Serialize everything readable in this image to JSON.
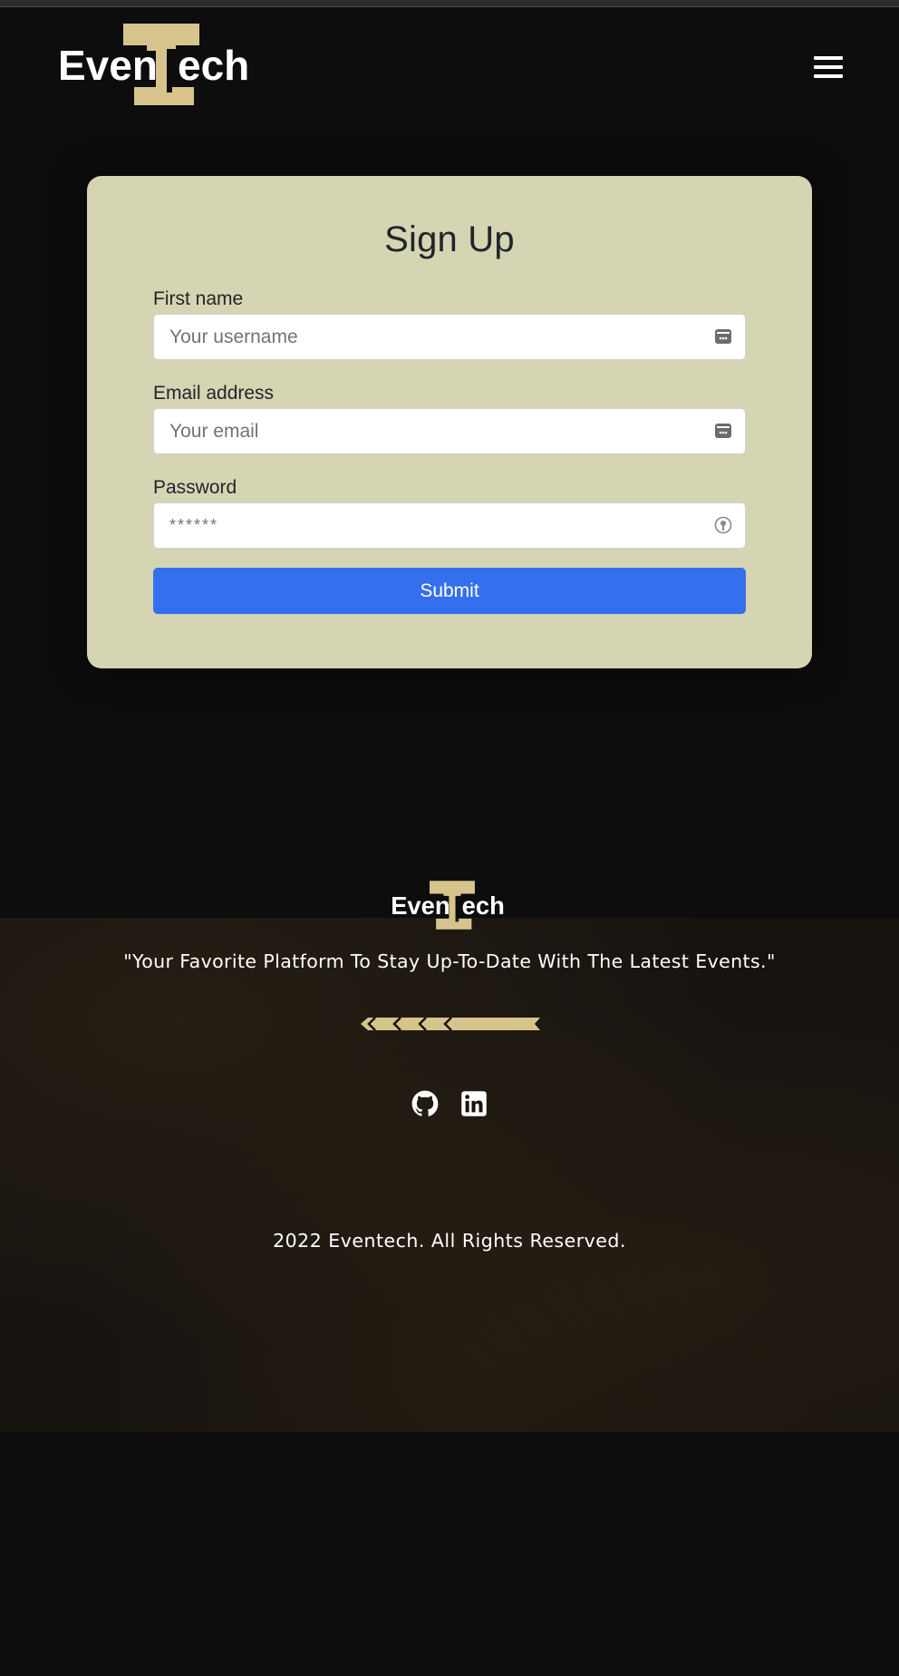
{
  "brand": {
    "logo_text_left": "Even",
    "logo_text_right": "ech",
    "logo_text_color": "#ffffff",
    "logo_accent": "#d6c48c"
  },
  "header": {
    "menu_icon": "hamburger-menu-icon"
  },
  "signup": {
    "title": "Sign Up",
    "first_name": {
      "label": "First name",
      "placeholder": "Your username",
      "value": "",
      "icon": "password-manager-icon"
    },
    "email": {
      "label": "Email address",
      "placeholder": "Your email",
      "value": "",
      "icon": "password-manager-icon"
    },
    "password": {
      "label": "Password",
      "placeholder": "******",
      "value": "",
      "icon": "key-icon"
    },
    "submit_label": "Submit"
  },
  "footer": {
    "tagline": "\"Your Favorite Platform To Stay Up-To-Date With The Latest Events.\"",
    "divider_icon": "arrow-ornament-divider",
    "social": [
      {
        "name": "GitHub",
        "icon": "github-icon"
      },
      {
        "name": "LinkedIn",
        "icon": "linkedin-icon"
      }
    ],
    "copyright": "2022 Eventech. All Rights Reserved."
  },
  "colors": {
    "page_background": "#0d0d0e",
    "card_background": "#d5d5b3",
    "submit_button": "#3470ed",
    "accent_gold": "#d6c48c"
  }
}
